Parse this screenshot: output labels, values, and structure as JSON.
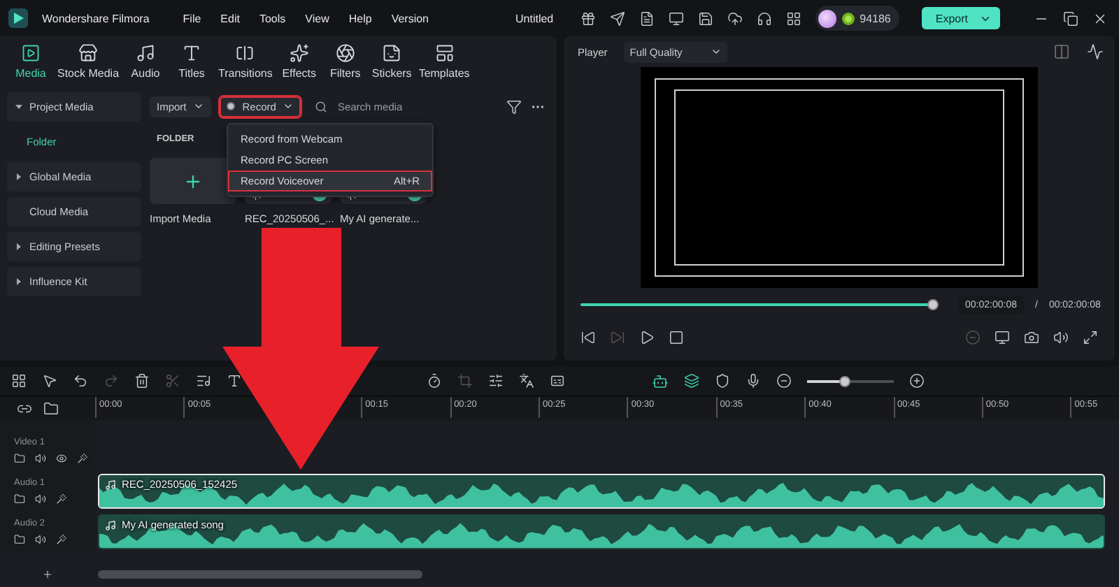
{
  "app": {
    "name": "Wondershare Filmora"
  },
  "menu": [
    "File",
    "Edit",
    "Tools",
    "View",
    "Help",
    "Version"
  ],
  "document_title": "Untitled",
  "credits": "94186",
  "export_button": "Export",
  "tabs": [
    {
      "label": "Media",
      "selected": true
    },
    {
      "label": "Stock Media",
      "selected": false
    },
    {
      "label": "Audio",
      "selected": false
    },
    {
      "label": "Titles",
      "selected": false
    },
    {
      "label": "Transitions",
      "selected": false
    },
    {
      "label": "Effects",
      "selected": false
    },
    {
      "label": "Filters",
      "selected": false
    },
    {
      "label": "Stickers",
      "selected": false
    },
    {
      "label": "Templates",
      "selected": false
    }
  ],
  "sidebar": [
    {
      "label": "Project Media",
      "kind": "group",
      "expanded": true,
      "selected": false
    },
    {
      "label": "Folder",
      "kind": "sub",
      "selected": true
    },
    {
      "label": "Global Media",
      "kind": "group",
      "expanded": false,
      "selected": false
    },
    {
      "label": "Cloud Media",
      "kind": "plain",
      "selected": false
    },
    {
      "label": "Editing Presets",
      "kind": "group",
      "expanded": false,
      "selected": false
    },
    {
      "label": "Influence Kit",
      "kind": "group",
      "expanded": false,
      "selected": false
    }
  ],
  "media_toolbar": {
    "import": "Import",
    "record": {
      "label": "Record",
      "highlighted": true
    },
    "search": {
      "placeholder": "Search media"
    }
  },
  "record_menu": [
    {
      "label": "Record from Webcam",
      "highlighted": false
    },
    {
      "label": "Record PC Screen",
      "highlighted": false
    },
    {
      "label": "Record Voiceover",
      "shortcut": "Alt+R",
      "highlighted": true
    }
  ],
  "section_label": "FOLDER",
  "media_items": [
    {
      "kind": "import",
      "label": "Import Media"
    },
    {
      "kind": "audio",
      "label": "REC_20250506_...",
      "added": true
    },
    {
      "kind": "audio",
      "label": "My AI generate...",
      "added": true
    }
  ],
  "player": {
    "label": "Player",
    "quality": "Full Quality",
    "progress": {
      "level": 1
    },
    "current_time": "00:02:00:08",
    "separator": "/",
    "total_time": "00:02:00:08"
  },
  "timeline": {
    "zoom": {
      "level": 0.43
    },
    "ruler_before": [
      "00:00",
      "00:05"
    ],
    "ruler_after": [
      "00:15",
      "00:20",
      "00:25",
      "00:30",
      "00:35",
      "00:40",
      "00:45",
      "00:50",
      "00:55"
    ],
    "tracks": [
      {
        "label": "Video 1",
        "kind": "video"
      },
      {
        "label": "Audio 1",
        "kind": "audio",
        "clip": {
          "label": "REC_20250506_152425",
          "selected": true
        }
      },
      {
        "label": "Audio 2",
        "kind": "audio",
        "clip": {
          "label": "My AI generated song",
          "selected": false
        }
      }
    ]
  }
}
